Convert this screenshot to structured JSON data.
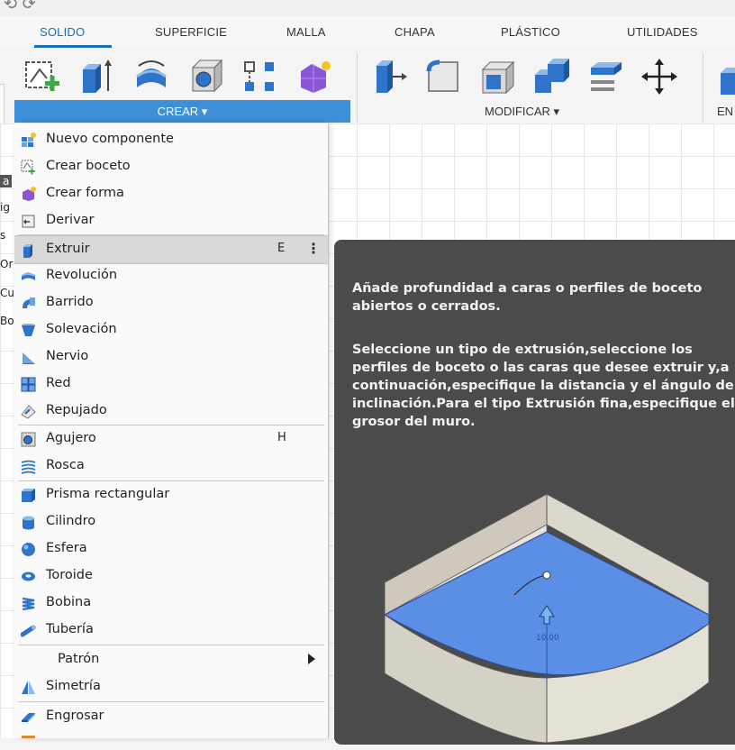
{
  "tabs": [
    "SOLIDO",
    "SUPERFICIE",
    "MALLA",
    "CHAPA",
    "PLÁSTICO",
    "UTILIDADES"
  ],
  "toolbar": {
    "crear_label": "CREAR ▾",
    "modificar_label": "MODIFICAR ▾",
    "next_group_partial": "EN",
    "icons": [
      "create-sketch-icon",
      "extrude-icon",
      "revolve-icon",
      "hole-icon",
      "pattern-icon",
      "create-form-icon",
      "press-pull-icon",
      "fillet-icon",
      "shell-icon",
      "combine-icon",
      "align-icon",
      "move-icon",
      "partial-icon"
    ]
  },
  "browser_fragment": [
    "a",
    "ig",
    "s",
    "Or",
    "Cu",
    "Bo"
  ],
  "menu": {
    "items": [
      {
        "label": "Nuevo componente",
        "icon": "new-component-icon"
      },
      {
        "label": "Crear boceto",
        "icon": "create-sketch-icon"
      },
      {
        "label": "Crear forma",
        "icon": "create-form-icon"
      },
      {
        "label": "Derivar",
        "icon": "derive-icon"
      },
      {
        "label": "Extruir",
        "icon": "extrude-icon",
        "shortcut": "E",
        "more": "⋮",
        "highlighted": true
      },
      {
        "label": "Revolución",
        "icon": "revolve-icon"
      },
      {
        "label": "Barrido",
        "icon": "sweep-icon"
      },
      {
        "label": "Solevación",
        "icon": "loft-icon"
      },
      {
        "label": "Nervio",
        "icon": "rib-icon"
      },
      {
        "label": "Red",
        "icon": "web-icon"
      },
      {
        "label": "Repujado",
        "icon": "emboss-icon"
      },
      {
        "label": "Agujero",
        "icon": "hole-icon",
        "shortcut": "H"
      },
      {
        "label": "Rosca",
        "icon": "thread-icon"
      },
      {
        "label": "Prisma rectangular",
        "icon": "box-icon"
      },
      {
        "label": "Cilindro",
        "icon": "cylinder-icon"
      },
      {
        "label": "Esfera",
        "icon": "sphere-icon"
      },
      {
        "label": "Toroide",
        "icon": "torus-icon"
      },
      {
        "label": "Bobina",
        "icon": "coil-icon"
      },
      {
        "label": "Tubería",
        "icon": "pipe-icon"
      },
      {
        "label": "Patrón",
        "submenu": true
      },
      {
        "label": "Simetría",
        "icon": "mirror-icon"
      },
      {
        "label": "Engrosar",
        "icon": "thicken-icon"
      }
    ]
  },
  "tooltip": {
    "paragraph1": "Añade profundidad a caras o perfiles de boceto abiertos o cerrados.",
    "paragraph2": "Seleccione un tipo de extrusión,seleccione los perfiles de boceto o las caras que desee extruir y,a continuación,especifique la distancia y el ángulo de inclinación.Para el tipo Extrusión fina,especifique el grosor del muro.",
    "illustration_value": "10.00"
  },
  "colors": {
    "accent": "#1a6fb5",
    "crear_bar": "#3d8fd7",
    "tooltip_bg": "#4b4b4b",
    "extrude_blue": "#5b8fe6"
  }
}
